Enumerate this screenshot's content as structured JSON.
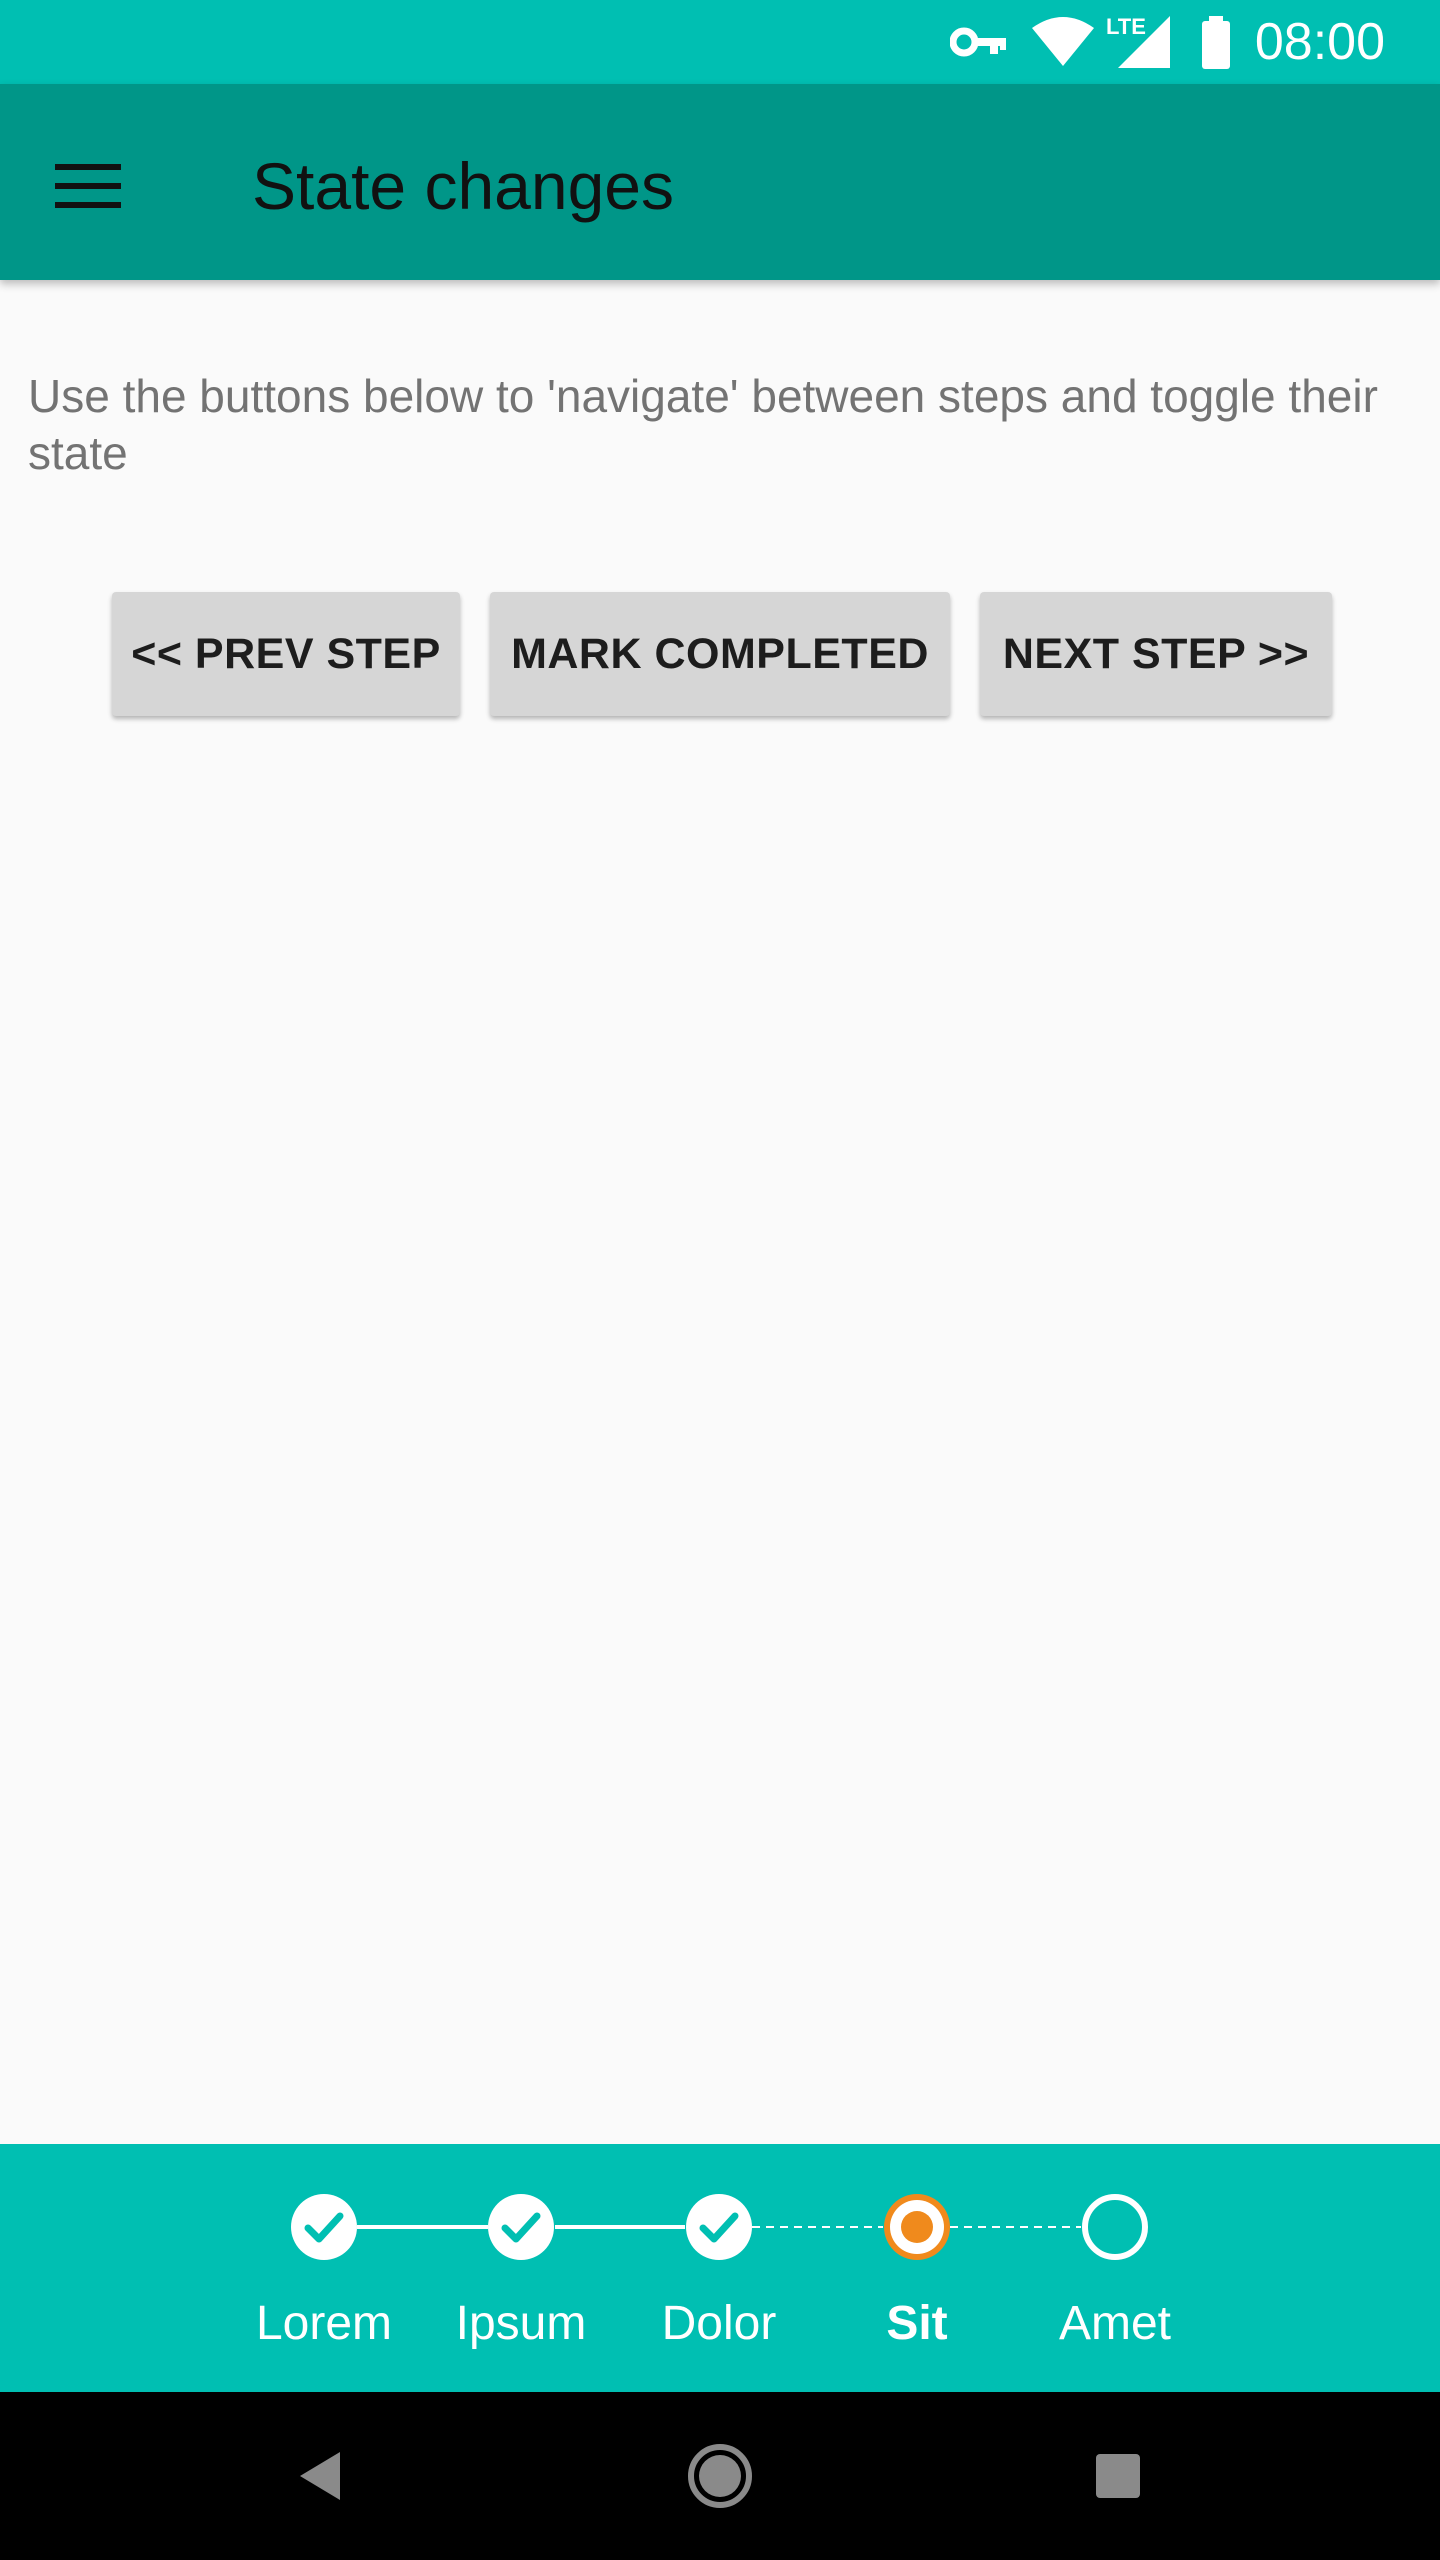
{
  "status_bar": {
    "time": "08:00",
    "icons": [
      "vpn-key-icon",
      "wifi-icon",
      "lte-signal-icon",
      "battery-icon"
    ],
    "network_label": "LTE"
  },
  "app_bar": {
    "title": "State changes",
    "menu_icon": "hamburger-menu-icon"
  },
  "content": {
    "instructions": "Use the buttons below to 'navigate' between steps and toggle their state"
  },
  "buttons": {
    "prev_label": "<< PREV STEP",
    "mark_label": "MARK COMPLETED",
    "next_label": "NEXT STEP >>"
  },
  "stepper": {
    "current_index": 3,
    "steps": [
      {
        "label": "Lorem",
        "state": "completed"
      },
      {
        "label": "Ipsum",
        "state": "completed"
      },
      {
        "label": "Dolor",
        "state": "completed"
      },
      {
        "label": "Sit",
        "state": "active"
      },
      {
        "label": "Amet",
        "state": "inactive"
      }
    ]
  },
  "colors": {
    "status_bar": "#00bfb2",
    "app_bar": "#009688",
    "stepper_bg": "#00bfb2",
    "active_step": "#f08a1c",
    "completed_check": "#00bfb2"
  },
  "nav_bar": {
    "icons": [
      "back-icon",
      "home-icon",
      "recents-icon"
    ]
  }
}
